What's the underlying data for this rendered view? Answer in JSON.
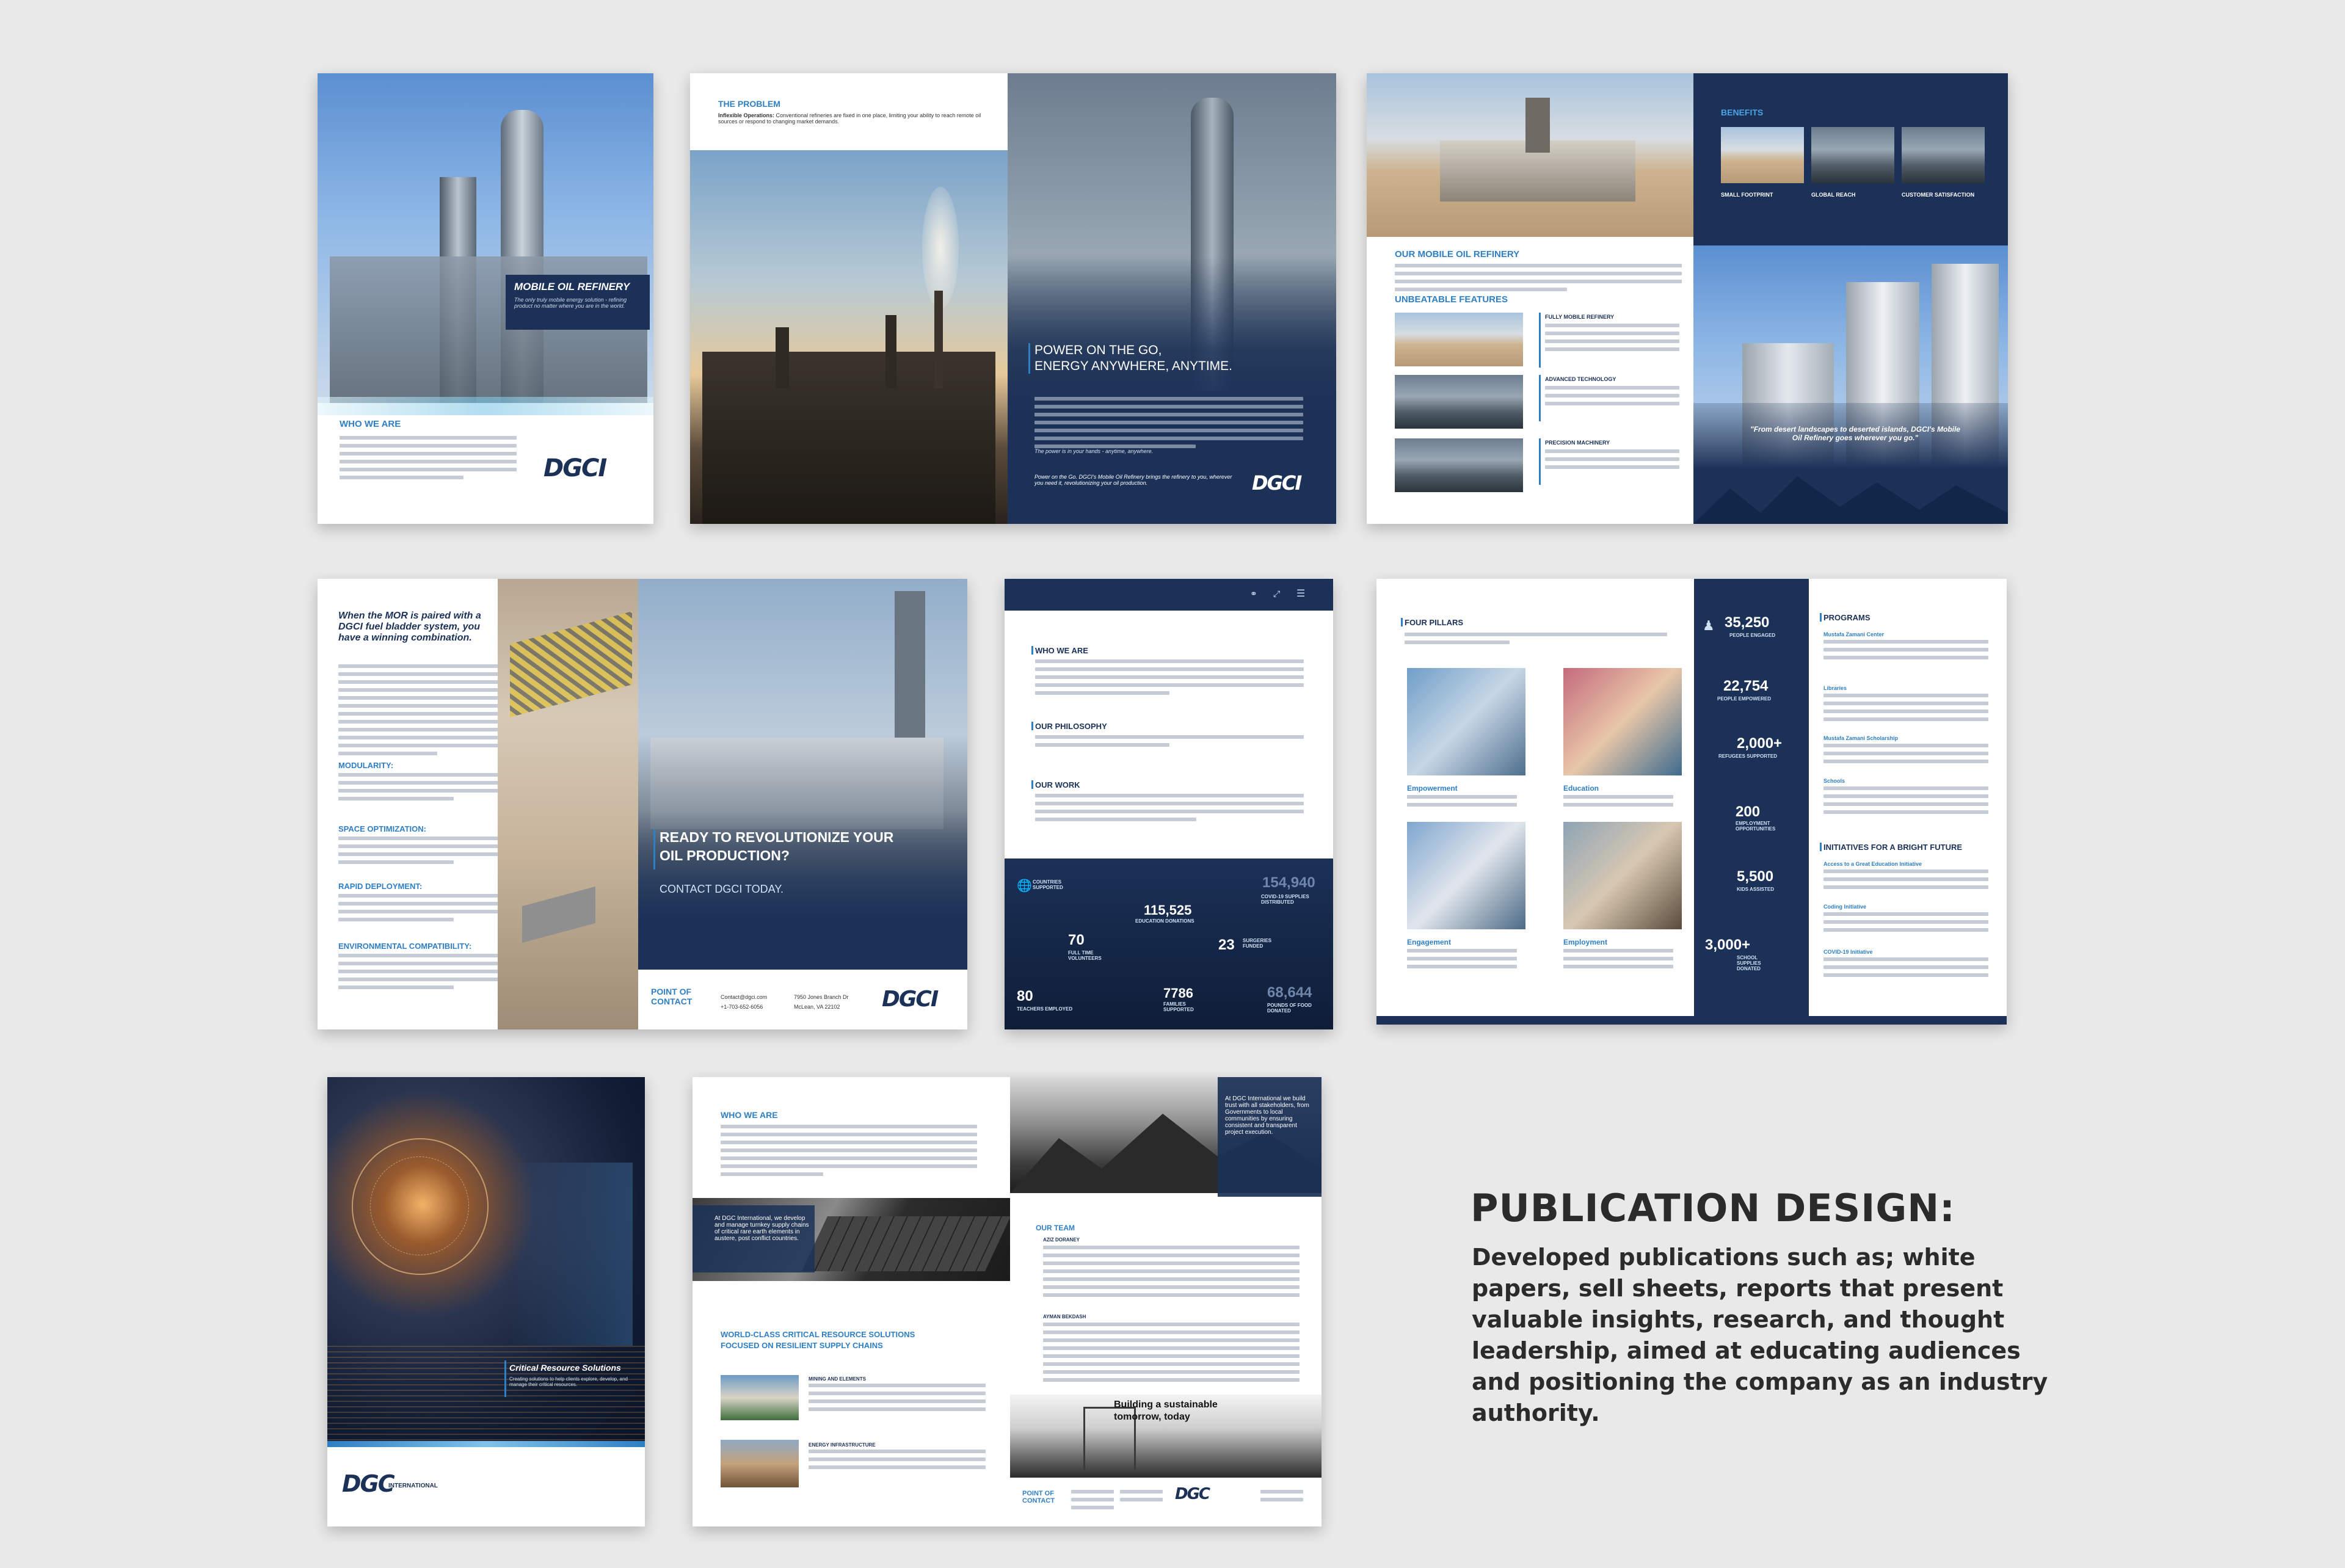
{
  "brochure1": {
    "hero_title": "MOBILE OIL REFINERY",
    "hero_sub": "The only truly mobile energy solution - refining product no matter where you are in the world.",
    "section": "WHO WE ARE",
    "logo": "DGCI"
  },
  "brochure2": {
    "problem_label": "THE PROBLEM",
    "problem_lead": "Inflexible Operations:",
    "problem_text": "Conventional refineries are fixed in one place, limiting your ability to reach remote oil sources or respond to changing market demands.",
    "headline_1": "POWER ON THE GO,",
    "headline_2": "ENERGY ANYWHERE, ANYTIME.",
    "tagline": "The power is in your hands - anytime, anywhere.",
    "closing": "Power on the Go. DGCI's Mobile Oil Refinery brings the refinery to you, wherever you need it, revolutionizing your oil production.",
    "logo": "DGCI"
  },
  "brochure3": {
    "section": "OUR MOBILE OIL REFINERY",
    "features_title": "UNBEATABLE FEATURES",
    "features": [
      "FULLY MOBILE REFINERY",
      "ADVANCED TECHNOLOGY",
      "PRECISION MACHINERY"
    ],
    "benefits_title": "BENEFITS",
    "benefits": [
      "SMALL FOOTPRINT",
      "GLOBAL REACH",
      "CUSTOMER SATISFACTION"
    ],
    "quote": "\"From desert landscapes to deserted islands, DGCI's Mobile Oil Refinery goes wherever you go.\""
  },
  "brochure4": {
    "headline": "When the MOR is paired with a DGCI fuel bladder system, you have a winning combination.",
    "sections": [
      "MODULARITY:",
      "SPACE OPTIMIZATION:",
      "RAPID DEPLOYMENT:",
      "ENVIRONMENTAL COMPATIBILITY:"
    ],
    "cta_1": "READY TO REVOLUTIONIZE YOUR",
    "cta_2": "OIL PRODUCTION?",
    "cta_3": "CONTACT DGCI TODAY.",
    "poc": "POINT OF CONTACT",
    "email": "Contact@dgci.com",
    "phone": "+1-703-652-6056",
    "address_1": "7950 Jones Branch Dr",
    "address_2": "McLean, VA 22102",
    "logo": "DGCI"
  },
  "brochure5": {
    "sections": [
      "WHO WE ARE",
      "OUR PHILOSOPHY",
      "OUR WORK"
    ],
    "stats": [
      {
        "num": "115,525",
        "label": "EDUCATION DONATIONS"
      },
      {
        "num": "154,940",
        "label": "COVID-19 SUPPLIES DISTRIBUTED"
      },
      {
        "num": "70",
        "label": "FULL TIME VOLUNTEERS"
      },
      {
        "num": "23",
        "label": "SURGERIES FUNDED"
      },
      {
        "num": "80",
        "label": "TEACHERS EMPLOYED"
      },
      {
        "num": "7786",
        "label": "FAMILIES SUPPORTED"
      },
      {
        "num": "68,644",
        "label": "POUNDS OF FOOD DONATED"
      }
    ],
    "countries_label": "COUNTRIES SUPPORTED"
  },
  "brochure6": {
    "pillars_title": "FOUR PILLARS",
    "pillars": [
      "Empowerment",
      "Education",
      "Engagement",
      "Employment"
    ],
    "stats": [
      {
        "num": "35,250",
        "label": "PEOPLE ENGAGED"
      },
      {
        "num": "22,754",
        "label": "PEOPLE EMPOWERED"
      },
      {
        "num": "2,000+",
        "label": "REFUGEES SUPPORTED"
      },
      {
        "num": "200",
        "label": "EMPLOYMENT OPPORTUNITIES"
      },
      {
        "num": "5,500",
        "label": "KIDS ASSISTED"
      },
      {
        "num": "3,000+",
        "label": "SCHOOL SUPPLIES DONATED"
      }
    ],
    "programs_title": "PROGRAMS",
    "programs": [
      "Mustafa Zamani Center",
      "Libraries",
      "Mustafa Zamani Scholarship",
      "Schools"
    ],
    "initiatives_title": "INITIATIVES FOR A BRIGHT FUTURE",
    "initiatives": [
      "Access to a Great Education Initiative",
      "Coding Initiative",
      "COVID-19 Initiative"
    ]
  },
  "brochure7": {
    "title": "Critical Resource Solutions",
    "sub": "Creating solutions to help clients explore, develop, and manage their critical resources.",
    "logo": "DGC",
    "logo_suffix": "INTERNATIONAL"
  },
  "brochure8": {
    "who": "WHO WE ARE",
    "quote_left": "At DGC International, we develop and manage turnkey supply chains of critical rare earth elements in austere, post conflict countries.",
    "quote_right": "At DGC International we build trust with all stakeholders, from Governments to local communities by ensuring consistent and transparent project execution.",
    "team": "OUR TEAM",
    "member_1": "AZIZ DORANEY",
    "member_2": "AYMAN BEKDASH",
    "solutions_1": "WORLD-CLASS CRITICAL RESOURCE SOLUTIONS",
    "solutions_2": "FOCUSED ON RESILIENT SUPPLY CHAINS",
    "item_1": "MINING AND ELEMENTS",
    "item_2": "ENERGY INFRASTRUCTURE",
    "building_1": "Building a sustainable",
    "building_2": "tomorrow, today",
    "poc": "POINT OF CONTACT"
  },
  "caption": {
    "title": "PUBLICATION DESIGN:",
    "body": "Developed publications such as; white papers, sell sheets, reports that present valuable insights, research, and thought leadership, aimed at educating audiences and positioning the company as an industry authority."
  },
  "colors": {
    "navy": "#1b3157",
    "accent": "#2f7fc4",
    "background": "#e9e9e9"
  }
}
